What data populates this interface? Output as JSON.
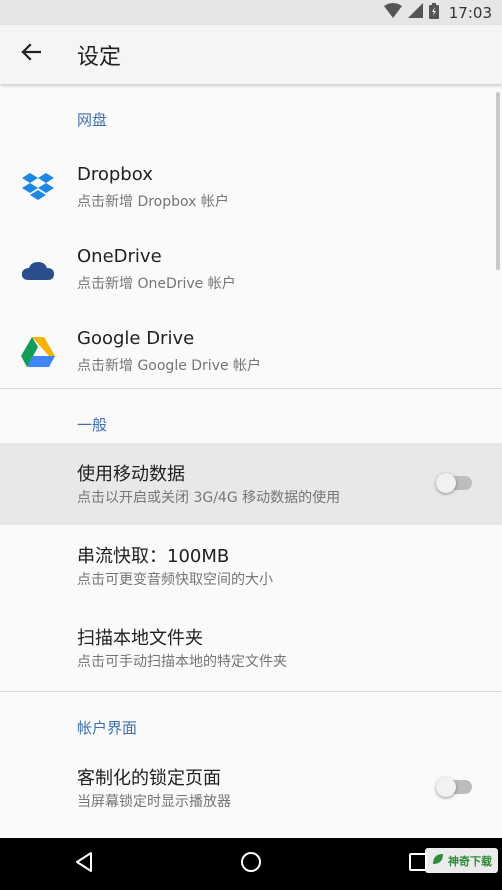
{
  "status_bar": {
    "time": "17:03",
    "icons": [
      "wifi-icon",
      "signal-icon",
      "battery-icon"
    ]
  },
  "app_bar": {
    "back_icon": "arrow-left-icon",
    "title": "设定"
  },
  "sections": [
    {
      "header": "网盘",
      "items": [
        {
          "icon": "dropbox-icon",
          "title": "Dropbox",
          "summary": "点击新增 Dropbox 帐户"
        },
        {
          "icon": "onedrive-icon",
          "title": "OneDrive",
          "summary": "点击新增 OneDrive 帐户"
        },
        {
          "icon": "google-drive-icon",
          "title": "Google Drive",
          "summary": "点击新增 Google Drive 帐户"
        }
      ]
    },
    {
      "header": "一般",
      "items": [
        {
          "title": "使用移动数据",
          "summary": "点击以开启或关闭 3G/4G 移动数据的使用",
          "switch": false
        },
        {
          "title": "串流快取：100MB",
          "summary": "点击可更变音频快取空间的大小"
        },
        {
          "title": "扫描本地文件夹",
          "summary": "点击可手动扫描本地的特定文件夹"
        }
      ]
    },
    {
      "header": "帐户界面",
      "items": [
        {
          "title": "客制化的锁定页面",
          "summary": "当屏幕锁定时显示播放器",
          "switch": false
        }
      ]
    }
  ],
  "nav_bar": {
    "icons": [
      "back-triangle-icon",
      "home-circle-icon",
      "recents-square-icon"
    ]
  },
  "watermark": {
    "text": "神奇下载"
  },
  "colors": {
    "accent": "#3f6fb0",
    "dropbox": "#1e88e5",
    "onedrive": "#2b4f8c",
    "drive_green": "#0f9d58",
    "drive_yellow": "#f4b400",
    "drive_blue": "#4285f4"
  }
}
